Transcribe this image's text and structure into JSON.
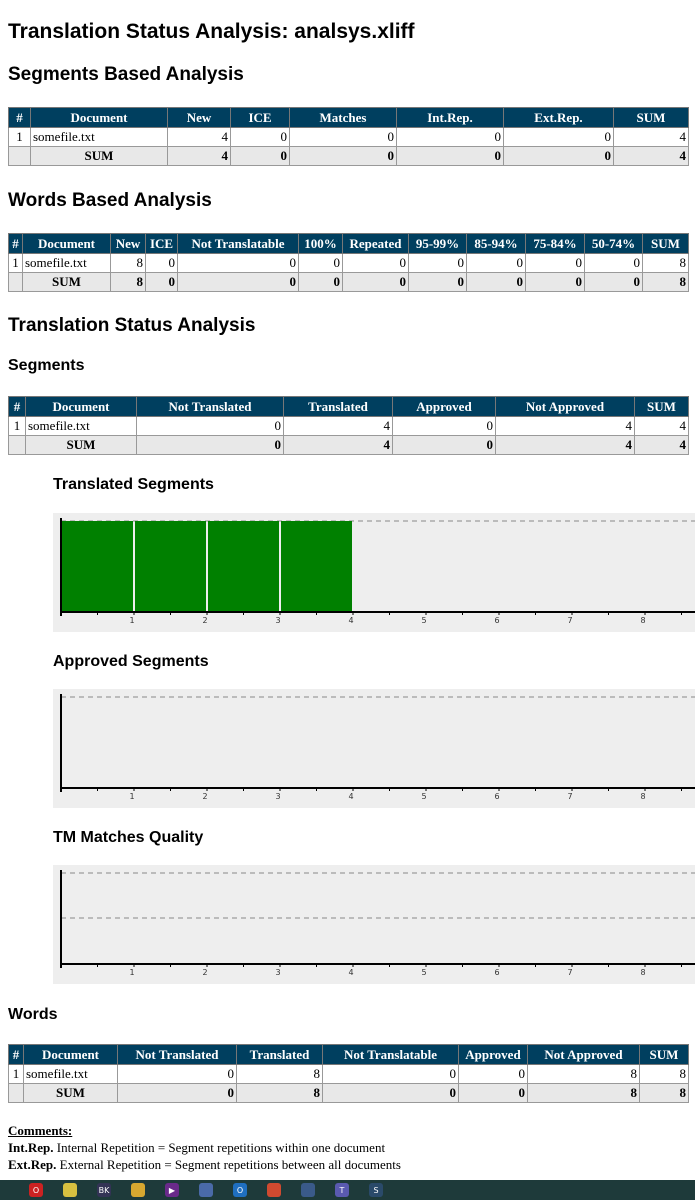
{
  "title": "Translation Status Analysis: analsys.xliff",
  "segments_based": {
    "heading": "Segments Based Analysis",
    "columns": [
      "#",
      "Document",
      "New",
      "ICE",
      "Matches",
      "Int.Rep.",
      "Ext.Rep.",
      "SUM"
    ],
    "rows": [
      [
        "1",
        "somefile.txt",
        "4",
        "0",
        "0",
        "0",
        "0",
        "4"
      ]
    ],
    "sum": [
      "",
      "SUM",
      "4",
      "0",
      "0",
      "0",
      "0",
      "4"
    ]
  },
  "words_based": {
    "heading": "Words Based Analysis",
    "columns": [
      "#",
      "Document",
      "New",
      "ICE",
      "Not Translatable",
      "100%",
      "Repeated",
      "95-99%",
      "85-94%",
      "75-84%",
      "50-74%",
      "SUM"
    ],
    "rows": [
      [
        "1",
        "somefile.txt",
        "8",
        "0",
        "0",
        "0",
        "0",
        "0",
        "0",
        "0",
        "0",
        "8"
      ]
    ],
    "sum": [
      "",
      "SUM",
      "8",
      "0",
      "0",
      "0",
      "0",
      "0",
      "0",
      "0",
      "0",
      "8"
    ]
  },
  "status": {
    "heading": "Translation Status Analysis",
    "segments_heading": "Segments",
    "segments": {
      "columns": [
        "#",
        "Document",
        "Not Translated",
        "Translated",
        "Approved",
        "Not Approved",
        "SUM"
      ],
      "rows": [
        [
          "1",
          "somefile.txt",
          "0",
          "4",
          "0",
          "4",
          "4"
        ]
      ],
      "sum": [
        "",
        "SUM",
        "0",
        "4",
        "0",
        "4",
        "4"
      ]
    },
    "words_heading": "Words",
    "words": {
      "columns": [
        "#",
        "Document",
        "Not Translated",
        "Translated",
        "Not Translatable",
        "Approved",
        "Not Approved",
        "SUM"
      ],
      "rows": [
        [
          "1",
          "somefile.txt",
          "0",
          "8",
          "0",
          "0",
          "8",
          "8"
        ]
      ],
      "sum": [
        "",
        "SUM",
        "0",
        "8",
        "0",
        "0",
        "8",
        "8"
      ]
    }
  },
  "chart_data": [
    {
      "type": "bar",
      "title": "Translated Segments",
      "x": [
        1,
        2,
        3,
        4
      ],
      "values": [
        1,
        1,
        1,
        1
      ],
      "xlim": [
        0,
        8.5
      ],
      "ticks": [
        1,
        2,
        3,
        4,
        5,
        6,
        7,
        8
      ],
      "color": "#008000",
      "grid": true
    },
    {
      "type": "bar",
      "title": "Approved Segments",
      "x": [],
      "values": [],
      "xlim": [
        0,
        8.5
      ],
      "ticks": [
        1,
        2,
        3,
        4,
        5,
        6,
        7,
        8
      ],
      "grid": true
    },
    {
      "type": "bar",
      "title": "TM Matches Quality",
      "x": [],
      "values": [],
      "xlim": [
        0,
        8.5
      ],
      "ticks": [
        1,
        2,
        3,
        4,
        5,
        6,
        7,
        8
      ],
      "grid": true
    }
  ],
  "comments": {
    "title": "Comments:",
    "lines": [
      {
        "term": "Int.Rep.",
        "text": " Internal Repetition = Segment repetitions within one document"
      },
      {
        "term": "Ext.Rep.",
        "text": " External Repetition = Segment repetitions between all documents"
      }
    ]
  },
  "taskbar": {
    "icons": [
      {
        "name": "opera-icon",
        "color": "#cc2222",
        "label": "O"
      },
      {
        "name": "bulb-icon",
        "color": "#d8c040",
        "label": ""
      },
      {
        "name": "app-icon",
        "color": "#333355",
        "label": "BK"
      },
      {
        "name": "folder-icon",
        "color": "#d8a830",
        "label": ""
      },
      {
        "name": "media-icon",
        "color": "#6a2a8a",
        "label": "▶"
      },
      {
        "name": "disk-icon",
        "color": "#4a6aa8",
        "label": ""
      },
      {
        "name": "outlook-icon",
        "color": "#1f6fc0",
        "label": "O"
      },
      {
        "name": "chrome-icon",
        "color": "#d04a30",
        "label": ""
      },
      {
        "name": "vpn-icon",
        "color": "#3a5a8a",
        "label": ""
      },
      {
        "name": "teams-icon",
        "color": "#5a5ab0",
        "label": "T"
      },
      {
        "name": "skype-icon",
        "color": "#2a4a6a",
        "label": "S"
      }
    ]
  }
}
